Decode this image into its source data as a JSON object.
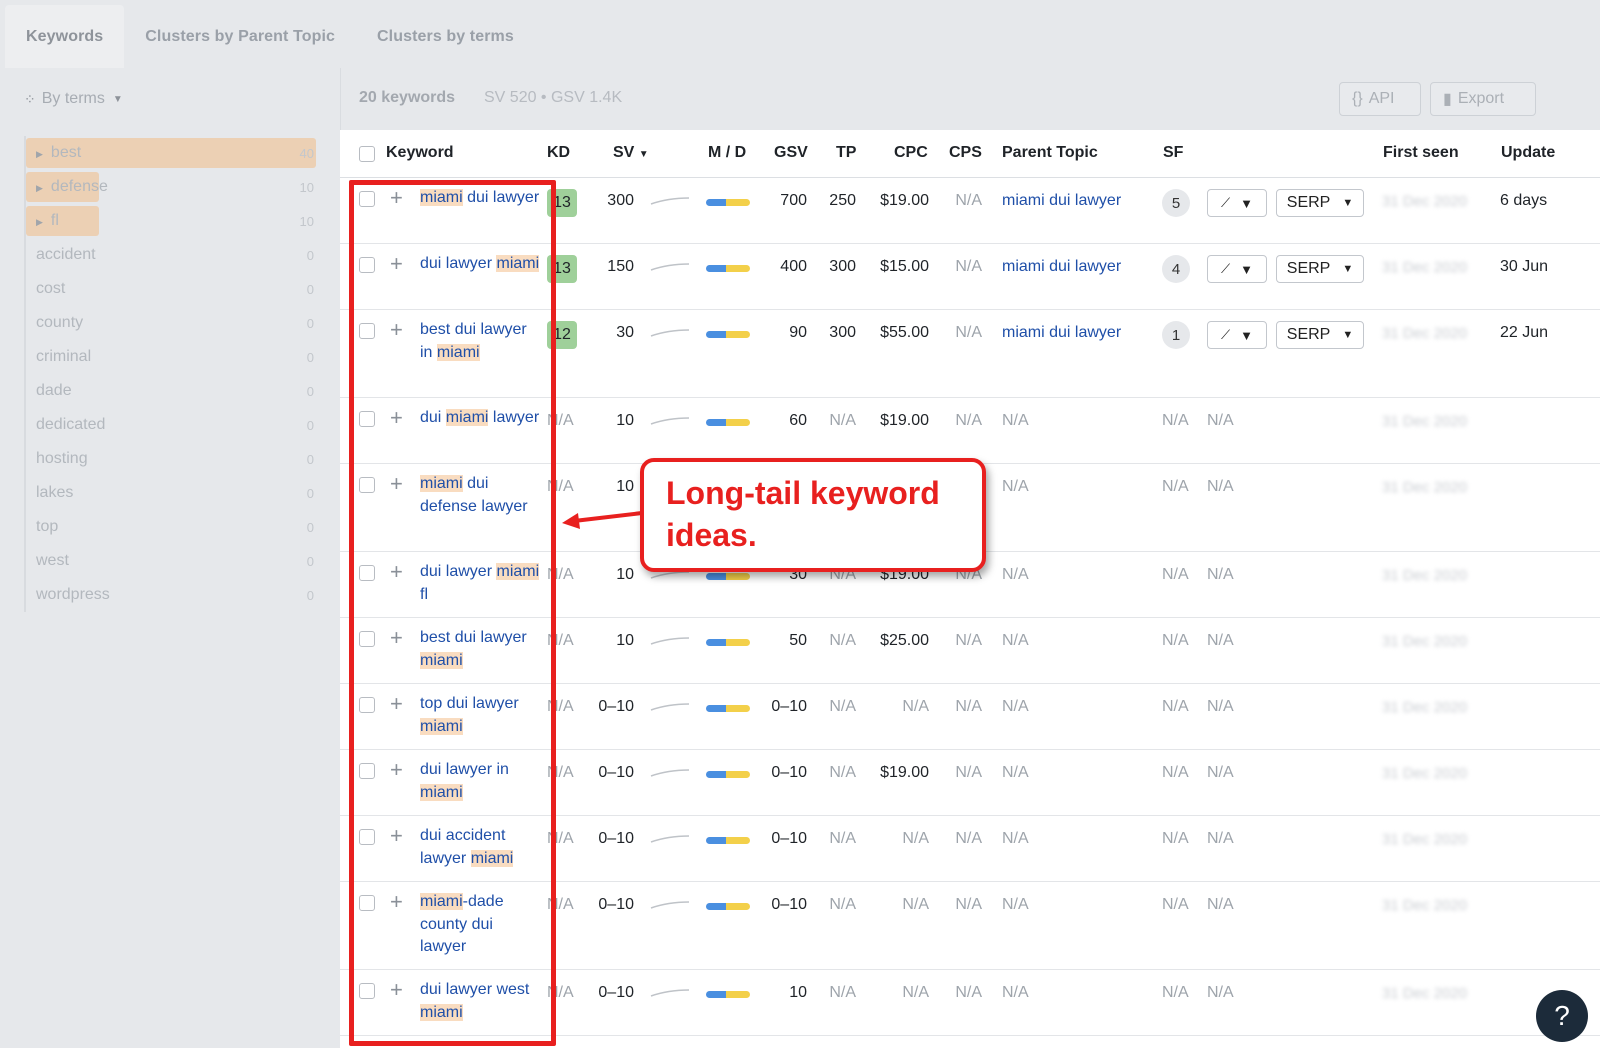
{
  "tabs": [
    "Keywords",
    "Clusters by Parent Topic",
    "Clusters by terms"
  ],
  "sidebar": {
    "group_by_label": "By terms",
    "terms": [
      {
        "name": "best",
        "count": "40",
        "expandable": true,
        "fill": 1.0
      },
      {
        "name": "defense",
        "count": "10",
        "expandable": true,
        "fill": 0.25
      },
      {
        "name": "fl",
        "count": "10",
        "expandable": true,
        "fill": 0.25
      },
      {
        "name": "accident",
        "count": "0",
        "expandable": false,
        "fill": 0
      },
      {
        "name": "cost",
        "count": "0",
        "expandable": false,
        "fill": 0
      },
      {
        "name": "county",
        "count": "0",
        "expandable": false,
        "fill": 0
      },
      {
        "name": "criminal",
        "count": "0",
        "expandable": false,
        "fill": 0
      },
      {
        "name": "dade",
        "count": "0",
        "expandable": false,
        "fill": 0
      },
      {
        "name": "dedicated",
        "count": "0",
        "expandable": false,
        "fill": 0
      },
      {
        "name": "hosting",
        "count": "0",
        "expandable": false,
        "fill": 0
      },
      {
        "name": "lakes",
        "count": "0",
        "expandable": false,
        "fill": 0
      },
      {
        "name": "top",
        "count": "0",
        "expandable": false,
        "fill": 0
      },
      {
        "name": "west",
        "count": "0",
        "expandable": false,
        "fill": 0
      },
      {
        "name": "wordpress",
        "count": "0",
        "expandable": false,
        "fill": 0
      }
    ]
  },
  "summary": {
    "keywords": "20 keywords",
    "meta": "SV 520  •  GSV 1.4K"
  },
  "buttons": {
    "api": "API",
    "export": "Export"
  },
  "columns": {
    "keyword": "Keyword",
    "kd": "KD",
    "sv": "SV",
    "md": "M / D",
    "gsv": "GSV",
    "tp": "TP",
    "cpc": "CPC",
    "cps": "CPS",
    "parent": "Parent Topic",
    "sf": "SF",
    "first_seen": "First seen",
    "updated": "Update"
  },
  "rows": [
    {
      "kw": [
        [
          "miami",
          true
        ],
        [
          " dui lawyer",
          false
        ]
      ],
      "kd": "13",
      "sv": "300",
      "gsv": "700",
      "tp": "250",
      "cpc": "$19.00",
      "cps": "N/A",
      "parent": "miami dui lawyer",
      "sf": "5",
      "serp": "SERP",
      "first_seen": "31 Dec 2020",
      "updated": "6 days"
    },
    {
      "kw": [
        [
          "dui lawyer ",
          false
        ],
        [
          "miami",
          true
        ]
      ],
      "kd": "13",
      "sv": "150",
      "gsv": "400",
      "tp": "300",
      "cpc": "$15.00",
      "cps": "N/A",
      "parent": "miami dui lawyer",
      "sf": "4",
      "serp": "SERP",
      "first_seen": "31 Dec 2020",
      "updated": "30 Jun"
    },
    {
      "kw": [
        [
          "best dui lawyer in ",
          false
        ],
        [
          "miami",
          true
        ]
      ],
      "kd": "12",
      "sv": "30",
      "gsv": "90",
      "tp": "300",
      "cpc": "$55.00",
      "cps": "N/A",
      "parent": "miami dui lawyer",
      "sf": "1",
      "serp": "SERP",
      "first_seen": "31 Dec 2020",
      "updated": "22 Jun"
    },
    {
      "kw": [
        [
          "dui ",
          false
        ],
        [
          "miami",
          true
        ],
        [
          " lawyer",
          false
        ]
      ],
      "kd": "N/A",
      "sv": "10",
      "gsv": "60",
      "tp": "N/A",
      "cpc": "$19.00",
      "cps": "N/A",
      "parent": "N/A",
      "sf": "N/A",
      "sf2": "N/A",
      "first_seen": "31 Dec 2020",
      "updated": ""
    },
    {
      "kw": [
        [
          "miami",
          true
        ],
        [
          " dui defense lawyer",
          false
        ]
      ],
      "kd": "N/A",
      "sv": "10",
      "gsv": "",
      "tp": "",
      "cpc": "",
      "cps": "N/A",
      "parent": "N/A",
      "sf": "N/A",
      "sf2": "N/A",
      "first_seen": "31 Dec 2020",
      "updated": ""
    },
    {
      "kw": [
        [
          "dui lawyer ",
          false
        ],
        [
          "miami",
          true
        ],
        [
          " fl",
          false
        ]
      ],
      "kd": "N/A",
      "sv": "10",
      "gsv": "30",
      "tp": "N/A",
      "cpc": "$19.00",
      "cps": "N/A",
      "parent": "N/A",
      "sf": "N/A",
      "sf2": "N/A",
      "first_seen": "31 Dec 2020",
      "updated": ""
    },
    {
      "kw": [
        [
          "best dui lawyer ",
          false
        ],
        [
          "miami",
          true
        ]
      ],
      "kd": "N/A",
      "sv": "10",
      "gsv": "50",
      "tp": "N/A",
      "cpc": "$25.00",
      "cps": "N/A",
      "parent": "N/A",
      "sf": "N/A",
      "sf2": "N/A",
      "first_seen": "31 Dec 2020",
      "updated": ""
    },
    {
      "kw": [
        [
          "top dui lawyer ",
          false
        ],
        [
          "miami",
          true
        ]
      ],
      "kd": "N/A",
      "sv": "0–10",
      "gsv": "0–10",
      "tp": "N/A",
      "cpc": "N/A",
      "cps": "N/A",
      "parent": "N/A",
      "sf": "N/A",
      "sf2": "N/A",
      "first_seen": "31 Dec 2020",
      "updated": ""
    },
    {
      "kw": [
        [
          "dui lawyer in ",
          false
        ],
        [
          "miami",
          true
        ]
      ],
      "kd": "N/A",
      "sv": "0–10",
      "gsv": "0–10",
      "tp": "N/A",
      "cpc": "$19.00",
      "cps": "N/A",
      "parent": "N/A",
      "sf": "N/A",
      "sf2": "N/A",
      "first_seen": "31 Dec 2020",
      "updated": ""
    },
    {
      "kw": [
        [
          "dui accident lawyer ",
          false
        ],
        [
          "miami",
          true
        ]
      ],
      "kd": "N/A",
      "sv": "0–10",
      "gsv": "0–10",
      "tp": "N/A",
      "cpc": "N/A",
      "cps": "N/A",
      "parent": "N/A",
      "sf": "N/A",
      "sf2": "N/A",
      "first_seen": "31 Dec 2020",
      "updated": ""
    },
    {
      "kw": [
        [
          "miami",
          true
        ],
        [
          "-dade county dui lawyer",
          false
        ]
      ],
      "kd": "N/A",
      "sv": "0–10",
      "gsv": "0–10",
      "tp": "N/A",
      "cpc": "N/A",
      "cps": "N/A",
      "parent": "N/A",
      "sf": "N/A",
      "sf2": "N/A",
      "first_seen": "31 Dec 2020",
      "updated": ""
    },
    {
      "kw": [
        [
          "dui lawyer west ",
          false
        ],
        [
          "miami",
          true
        ]
      ],
      "kd": "N/A",
      "sv": "0–10",
      "gsv": "10",
      "tp": "N/A",
      "cpc": "N/A",
      "cps": "N/A",
      "parent": "N/A",
      "sf": "N/A",
      "sf2": "N/A",
      "first_seen": "31 Dec 2020",
      "updated": ""
    }
  ],
  "callout": {
    "text": "Long-tail keyword ideas."
  },
  "colors": {
    "annotation_red": "#e8201f",
    "kd_green": "#9fd09a",
    "highlight": "#f9dcc0",
    "link": "#1f4fa8"
  },
  "help": {
    "label": "?"
  }
}
